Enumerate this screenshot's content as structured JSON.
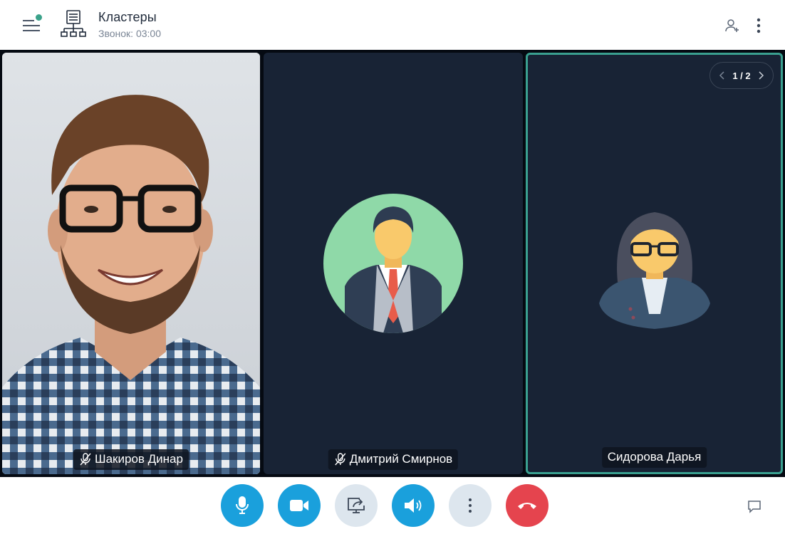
{
  "header": {
    "title": "Кластеры",
    "subtitle": "Звонок: 03:00",
    "status_dot_color": "#3aa28a"
  },
  "participants": [
    {
      "name": "Шакиров Динар",
      "muted": true,
      "video": true
    },
    {
      "name": "Дмитрий Смирнов",
      "muted": true,
      "video": false
    },
    {
      "name": "Сидорова Дарья",
      "muted": false,
      "video": false,
      "active_speaker": true
    }
  ],
  "pager": {
    "label": "1 / 2"
  },
  "controls": {
    "mic": "microphone-icon",
    "camera": "camera-icon",
    "screen_share": "screen-share-icon",
    "speaker": "speaker-icon",
    "more": "more-vertical-icon",
    "hangup": "hangup-icon"
  },
  "colors": {
    "accent": "#1aa0dc",
    "active_border": "#3aa090",
    "tile_bg": "#182335",
    "hangup": "#e5444e"
  }
}
